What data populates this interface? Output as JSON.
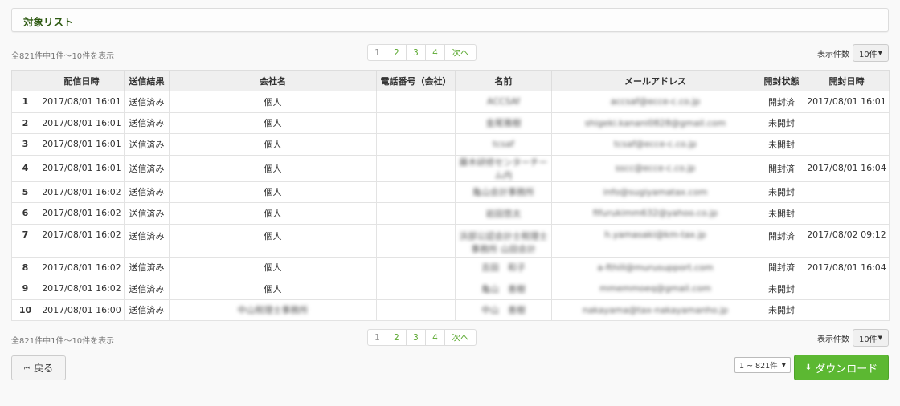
{
  "header": {
    "title": "対象リスト"
  },
  "summary_text": "全821件中1件〜10件を表示",
  "pagination": {
    "pages": [
      "1",
      "2",
      "3",
      "4"
    ],
    "next": "次へ"
  },
  "perpage": {
    "label": "表示件数",
    "value": "10件"
  },
  "columns": [
    "",
    "配信日時",
    "送信結果",
    "会社名",
    "電話番号（会社）",
    "名前",
    "メールアドレス",
    "開封状態",
    "開封日時"
  ],
  "rows": [
    {
      "no": "1",
      "date": "2017/08/01 16:01",
      "result": "送信済み",
      "company": "個人",
      "phone": "",
      "name": "ACCSAf",
      "email": "accsaf@ecce-c.co.jp",
      "status": "開封済",
      "status_type": "opened",
      "open_date": "2017/08/01 16:01",
      "tall": false,
      "company_blur": false
    },
    {
      "no": "2",
      "date": "2017/08/01 16:01",
      "result": "送信済み",
      "company": "個人",
      "phone": "",
      "name": "金尾雅樹",
      "email": "shigeki.kanani0828@gmail.com",
      "status": "未開封",
      "status_type": "unopened",
      "open_date": "",
      "tall": false,
      "company_blur": false
    },
    {
      "no": "3",
      "date": "2017/08/01 16:01",
      "result": "送信済み",
      "company": "個人",
      "phone": "",
      "name": "tcsaf",
      "email": "tcsaf@ecce-c.co.jp",
      "status": "未開封",
      "status_type": "unopened",
      "open_date": "",
      "tall": false,
      "company_blur": false
    },
    {
      "no": "4",
      "date": "2017/08/01 16:01",
      "result": "送信済み",
      "company": "個人",
      "phone": "",
      "name": "藤木研修センターチーム内",
      "email": "sscc@ecce-c.co.jp",
      "status": "開封済",
      "status_type": "opened",
      "open_date": "2017/08/01 16:04",
      "tall": false,
      "company_blur": false
    },
    {
      "no": "5",
      "date": "2017/08/01 16:02",
      "result": "送信済み",
      "company": "個人",
      "phone": "",
      "name": "亀山会計事務所",
      "email": "info@sugiyamatax.com",
      "status": "未開封",
      "status_type": "unopened",
      "open_date": "",
      "tall": false,
      "company_blur": false
    },
    {
      "no": "6",
      "date": "2017/08/01 16:02",
      "result": "送信済み",
      "company": "個人",
      "phone": "",
      "name": "岩田悠太",
      "email": "fifurukimm632@yahoo.co.jp",
      "status": "未開封",
      "status_type": "unopened",
      "open_date": "",
      "tall": false,
      "company_blur": false
    },
    {
      "no": "7",
      "date": "2017/08/01 16:02",
      "result": "送信済み",
      "company": "個人",
      "phone": "",
      "name": "浜部公認会計士税理士事務所 山田会計",
      "email": "h.yamasaki@km-tax.jp",
      "status": "開封済",
      "status_type": "opened",
      "open_date": "2017/08/02 09:12",
      "tall": true,
      "company_blur": false
    },
    {
      "no": "8",
      "date": "2017/08/01 16:02",
      "result": "送信済み",
      "company": "個人",
      "phone": "",
      "name": "吉田　和子",
      "email": "a-fthill@murusupport.com",
      "status": "開封済",
      "status_type": "opened",
      "open_date": "2017/08/01 16:04",
      "tall": false,
      "company_blur": false
    },
    {
      "no": "9",
      "date": "2017/08/01 16:02",
      "result": "送信済み",
      "company": "個人",
      "phone": "",
      "name": "亀山　善樹",
      "email": "mmemmoeq@gmail.com",
      "status": "未開封",
      "status_type": "unopened",
      "open_date": "",
      "tall": false,
      "company_blur": false
    },
    {
      "no": "10",
      "date": "2017/08/01 16:00",
      "result": "送信済み",
      "company": "中山税理士事務所",
      "phone": "",
      "name": "中山　善樹",
      "email": "nakayama@tax-nakayamanho.jp",
      "status": "未開封",
      "status_type": "unopened",
      "open_date": "",
      "tall": false,
      "company_blur": true
    }
  ],
  "back_button": {
    "label": "戻る"
  },
  "range_select": {
    "value": "1 ~ 821件"
  },
  "download_button": {
    "label": "ダウンロード"
  },
  "colors": {
    "accent": "#5cb832",
    "title": "#2e5a12",
    "unopened": "#1b2fd0",
    "muted": "#999999"
  }
}
